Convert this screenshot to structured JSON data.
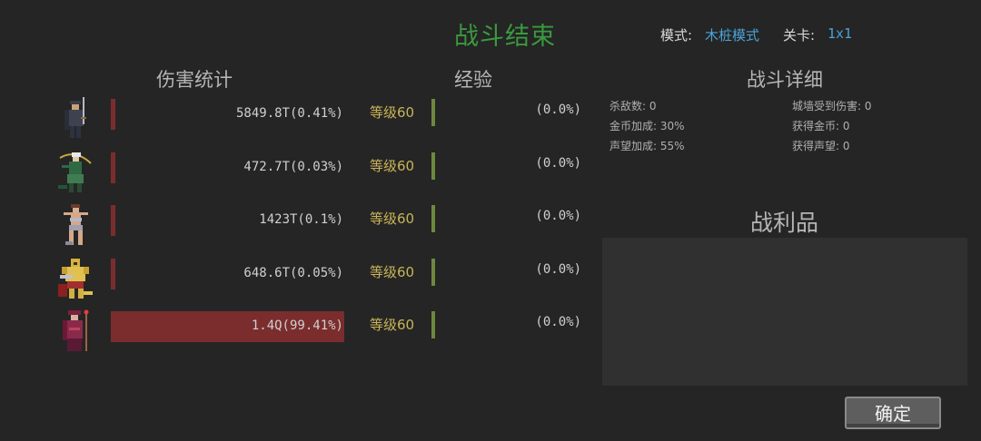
{
  "header": {
    "title": "战斗结束",
    "mode_label": "模式:",
    "mode_value": "木桩模式",
    "level_label": "关卡:",
    "level_value": "1x1"
  },
  "sections": {
    "damage": "伤害统计",
    "exp": "经验",
    "detail": "战斗详细",
    "loot": "战利品"
  },
  "heroes": [
    {
      "portrait": "dark-knight-portrait",
      "damage": "5849.8T(0.41%)",
      "share": 0.0041,
      "level": "等级60",
      "exp": "(0.0%)"
    },
    {
      "portrait": "elf-archer-portrait",
      "damage": "472.7T(0.03%)",
      "share": 0.0003,
      "level": "等级60",
      "exp": "(0.0%)"
    },
    {
      "portrait": "amazon-warrior-portrait",
      "damage": "1423T(0.1%)",
      "share": 0.001,
      "level": "等级60",
      "exp": "(0.0%)"
    },
    {
      "portrait": "golden-paladin-portrait",
      "damage": "648.6T(0.05%)",
      "share": 0.0005,
      "level": "等级60",
      "exp": "(0.0%)"
    },
    {
      "portrait": "crimson-mage-portrait",
      "damage": "1.4Q(99.41%)",
      "share": 0.9941,
      "level": "等级60",
      "exp": "(0.0%)"
    }
  ],
  "detail": {
    "kills": "杀敌数: 0",
    "gold_bonus": "金币加成: 30%",
    "rep_bonus": "声望加成: 55%",
    "wall_damage": "城墙受到伤害: 0",
    "gold_gained": "获得金币: 0",
    "rep_gained": "获得声望: 0"
  },
  "buttons": {
    "confirm": "确定"
  },
  "colors": {
    "accent_title": "#3a9a3e",
    "mode_value": "#4aa3d8",
    "damage_bar": "#7b2d2d",
    "level_text": "#c9b458",
    "exp_bar": "#6d8a3c"
  }
}
